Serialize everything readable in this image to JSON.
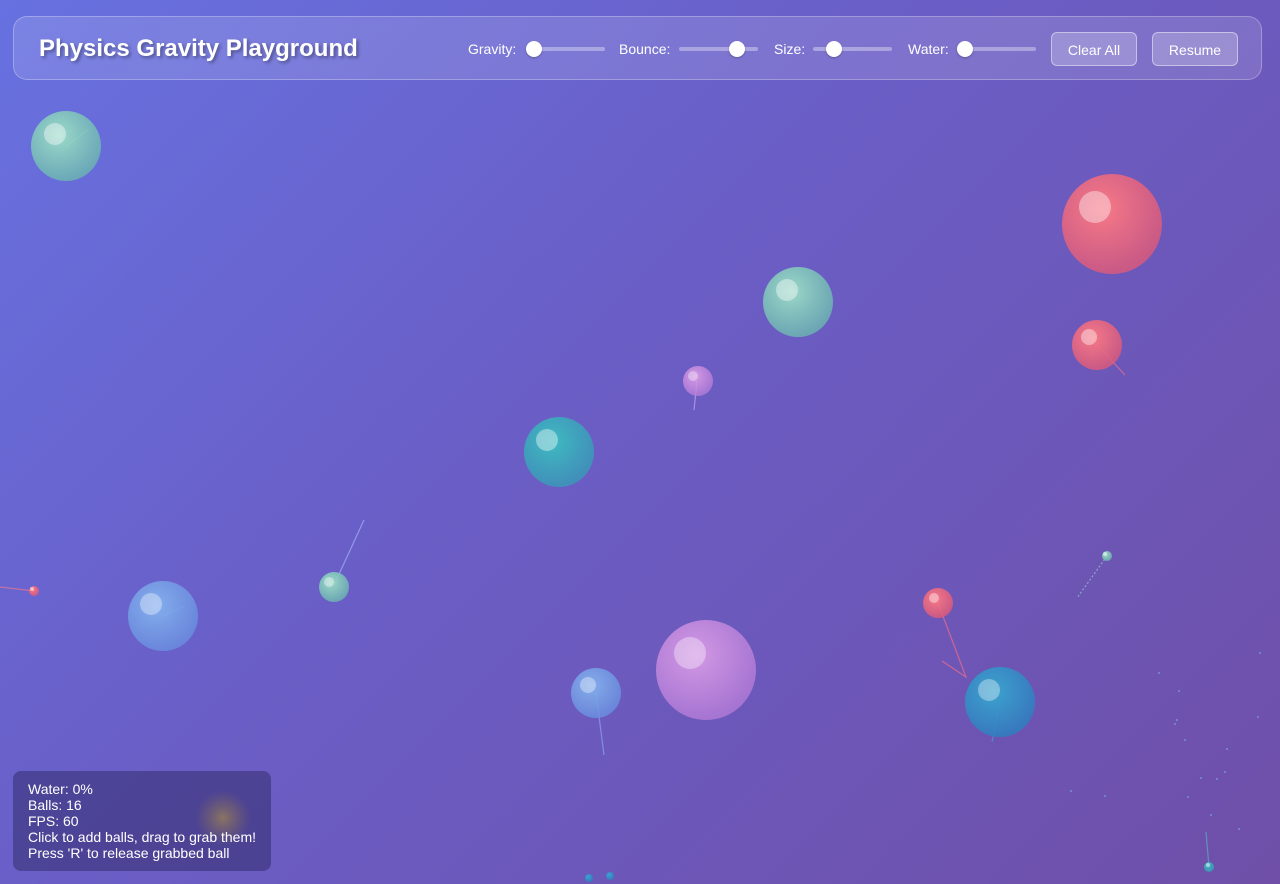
{
  "app": {
    "title": "Physics Gravity Playground"
  },
  "controls": {
    "sliders": [
      {
        "id": "gravity",
        "label": "Gravity:",
        "value": 0.0
      },
      {
        "id": "bounce",
        "label": "Bounce:",
        "value": 0.8
      },
      {
        "id": "size",
        "label": "Size:",
        "value": 0.2
      },
      {
        "id": "water",
        "label": "Water:",
        "value": 0.0
      }
    ],
    "clear_label": "Clear All",
    "resume_label": "Resume"
  },
  "info": {
    "water": "Water: 0%",
    "balls": "Balls: 16",
    "fps": "FPS: 60",
    "hint1": "Click to add balls, drag to grab them!",
    "hint2": "Press 'R' to release grabbed ball"
  },
  "colors": {
    "background_start": "#6771e0",
    "background_end": "#6f4fa8",
    "ball_green": "#7fc8b4",
    "ball_red": "#f06878",
    "ball_teal": "#3fb2b8",
    "ball_blue": "#78a8e8",
    "ball_purple": "#c890e0",
    "ball_ocean": "#2fa0c8",
    "ball_yellow": "#d8b060"
  }
}
